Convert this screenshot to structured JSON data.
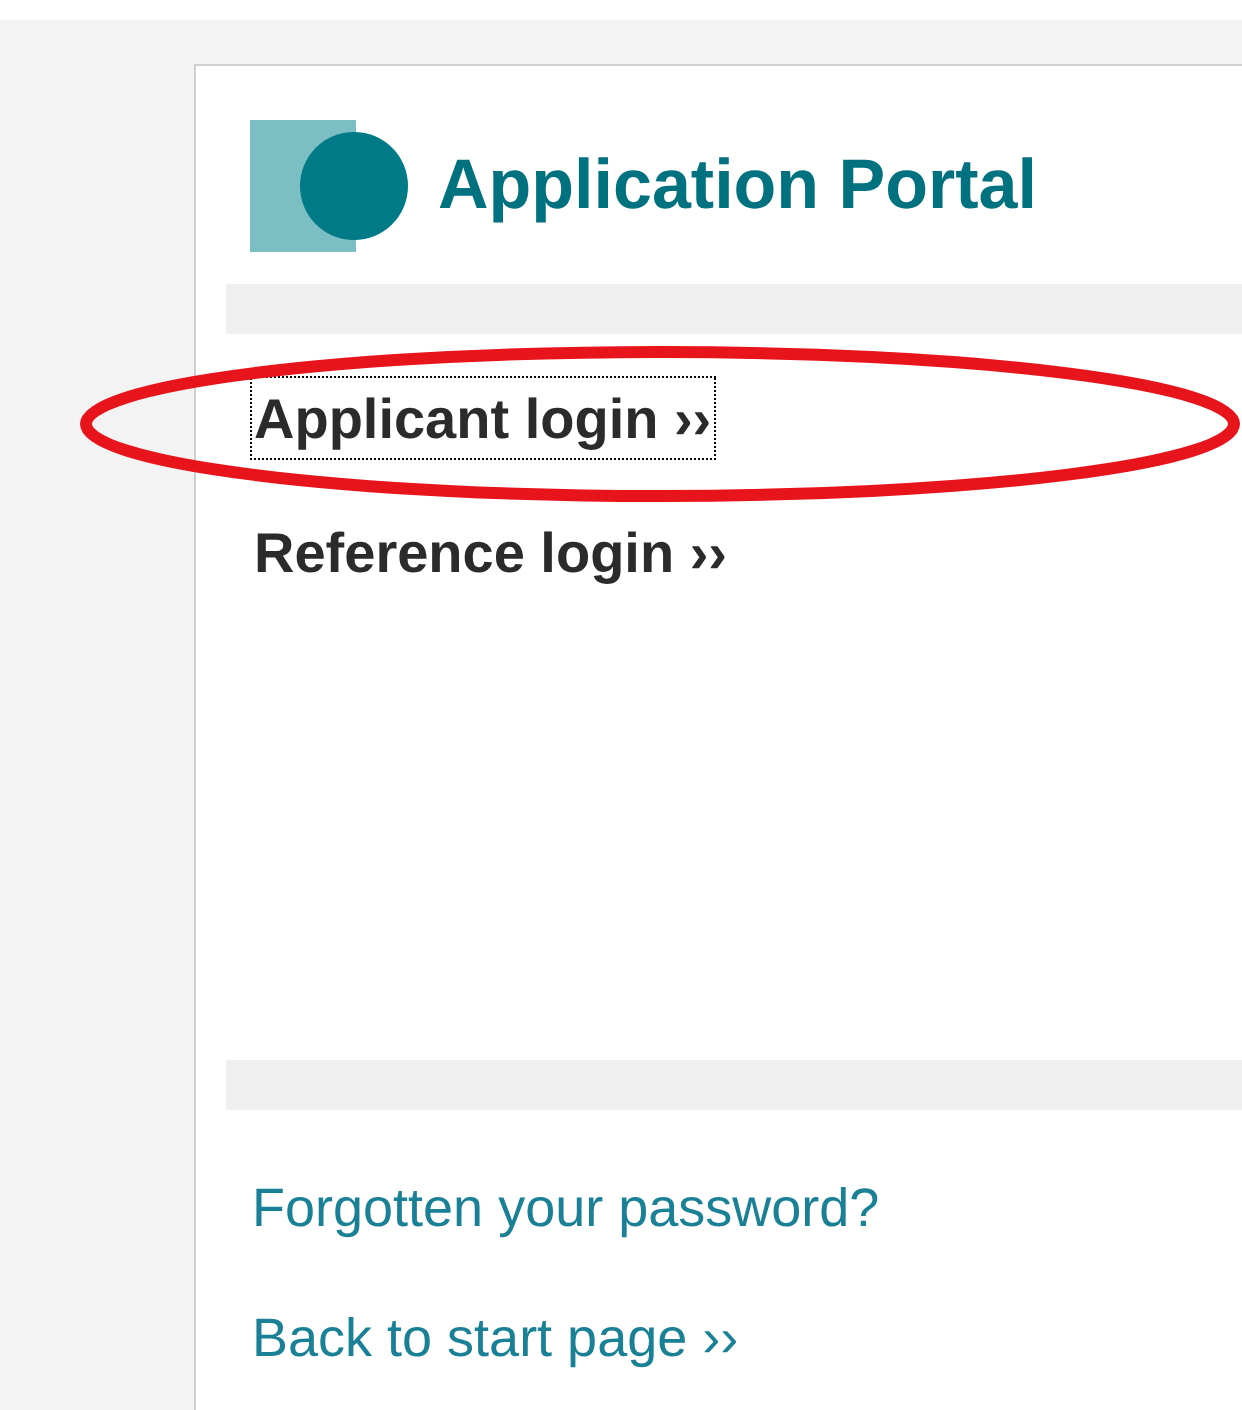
{
  "header": {
    "title": "Application Portal"
  },
  "login_links": [
    {
      "label": "Applicant login ››",
      "focused": true
    },
    {
      "label": "Reference login ››",
      "focused": false
    }
  ],
  "footer_links": [
    {
      "label": "Forgotten your password?"
    },
    {
      "label": "Back to start page ››"
    }
  ],
  "annotations": [
    {
      "kind": "ellipse"
    }
  ]
}
